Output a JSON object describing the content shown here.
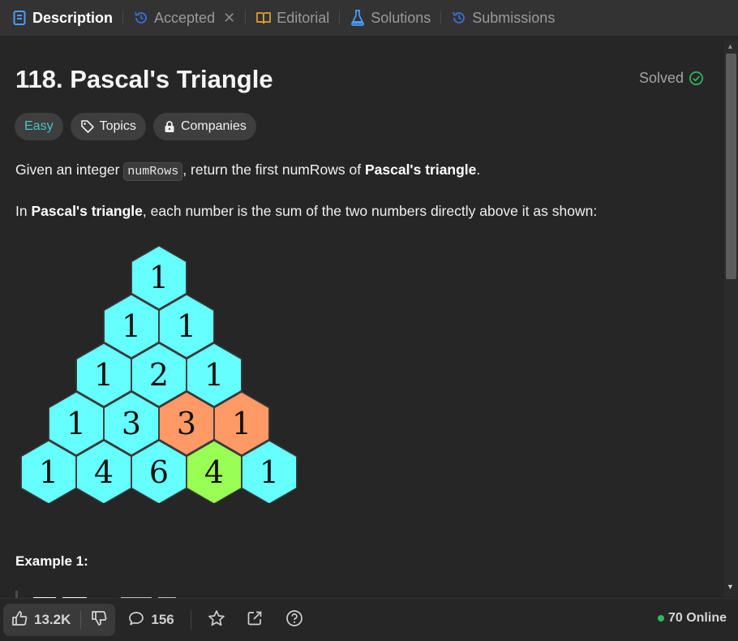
{
  "tabs": {
    "description": "Description",
    "accepted": "Accepted",
    "editorial": "Editorial",
    "solutions": "Solutions",
    "submissions": "Submissions"
  },
  "problem": {
    "title": "118. Pascal's Triangle",
    "status": "Solved",
    "difficulty": "Easy",
    "topics_label": "Topics",
    "companies_label": "Companies"
  },
  "description": {
    "p1_prefix": "Given an integer ",
    "p1_code": "numRows",
    "p1_mid": ", return the first numRows of ",
    "p1_bold": "Pascal's triangle",
    "p1_suffix": ".",
    "p2_prefix": "In ",
    "p2_bold": "Pascal's triangle",
    "p2_suffix": ", each number is the sum of the two numbers directly above it as shown:"
  },
  "triangle": {
    "rows": [
      [
        "1"
      ],
      [
        "1",
        "1"
      ],
      [
        "1",
        "2",
        "1"
      ],
      [
        "1",
        "3",
        "3",
        "1"
      ],
      [
        "1",
        "4",
        "6",
        "4",
        "1"
      ]
    ],
    "colors": {
      "default": "#66ffff",
      "highlight": "#ff9966",
      "sum": "#99ff55",
      "stroke": "#3a3a3a"
    }
  },
  "example_heading": "Example 1:",
  "bottom": {
    "likes": "13.2K",
    "comments": "156",
    "online": "70 Online"
  },
  "colors": {
    "background": "#262626",
    "tabbar": "#333333",
    "easy": "#46c6c2",
    "solved_check": "#2cbb5d",
    "online_dot": "#2cbb5d"
  }
}
